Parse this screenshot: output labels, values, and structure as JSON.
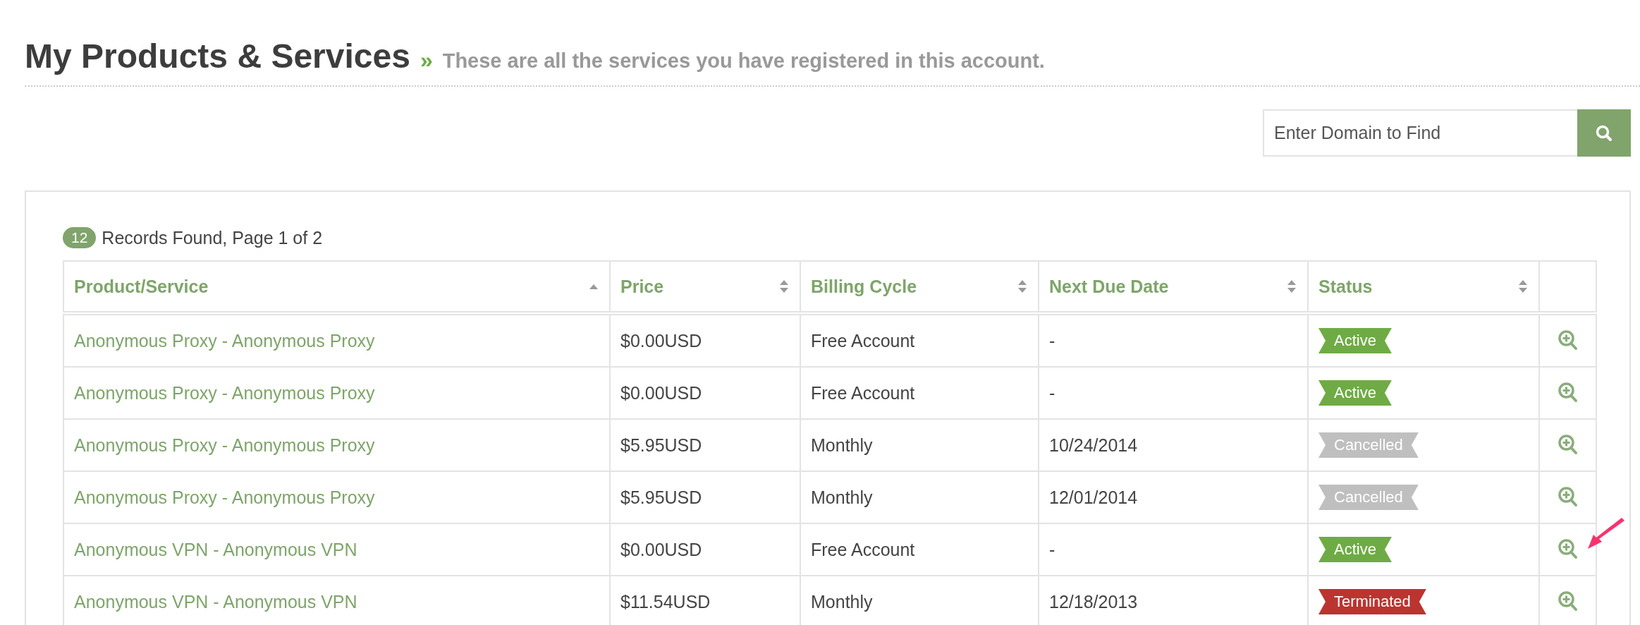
{
  "page_header": {
    "title": "My Products & Services",
    "separator": "»",
    "subtitle": "These are all the services you have registered in this account."
  },
  "search": {
    "placeholder": "Enter Domain to Find"
  },
  "summary": {
    "count": "12",
    "text": "Records Found, Page 1 of 2"
  },
  "table": {
    "columns": [
      {
        "label": "Product/Service",
        "sorted": true
      },
      {
        "label": "Price",
        "sorted": false
      },
      {
        "label": "Billing Cycle",
        "sorted": false
      },
      {
        "label": "Next Due Date",
        "sorted": false
      },
      {
        "label": "Status",
        "sorted": false
      }
    ],
    "rows": [
      {
        "product": "Anonymous Proxy - Anonymous Proxy",
        "price": "$0.00USD",
        "billing_cycle": "Free Account",
        "next_due_date": "-",
        "status": "Active",
        "color": "#6fab44"
      },
      {
        "product": "Anonymous Proxy - Anonymous Proxy",
        "price": "$0.00USD",
        "billing_cycle": "Free Account",
        "next_due_date": "-",
        "status": "Active",
        "color": "#6fab44"
      },
      {
        "product": "Anonymous Proxy - Anonymous Proxy",
        "price": "$5.95USD",
        "billing_cycle": "Monthly",
        "next_due_date": "10/24/2014",
        "status": "Cancelled",
        "color": "#bfbfbf"
      },
      {
        "product": "Anonymous Proxy - Anonymous Proxy",
        "price": "$5.95USD",
        "billing_cycle": "Monthly",
        "next_due_date": "12/01/2014",
        "status": "Cancelled",
        "color": "#bfbfbf"
      },
      {
        "product": "Anonymous VPN - Anonymous VPN",
        "price": "$0.00USD",
        "billing_cycle": "Free Account",
        "next_due_date": "-",
        "status": "Active",
        "color": "#6fab44"
      },
      {
        "product": "Anonymous VPN - Anonymous VPN",
        "price": "$11.54USD",
        "billing_cycle": "Monthly",
        "next_due_date": "12/18/2013",
        "status": "Terminated",
        "color": "#bb3430"
      }
    ]
  }
}
